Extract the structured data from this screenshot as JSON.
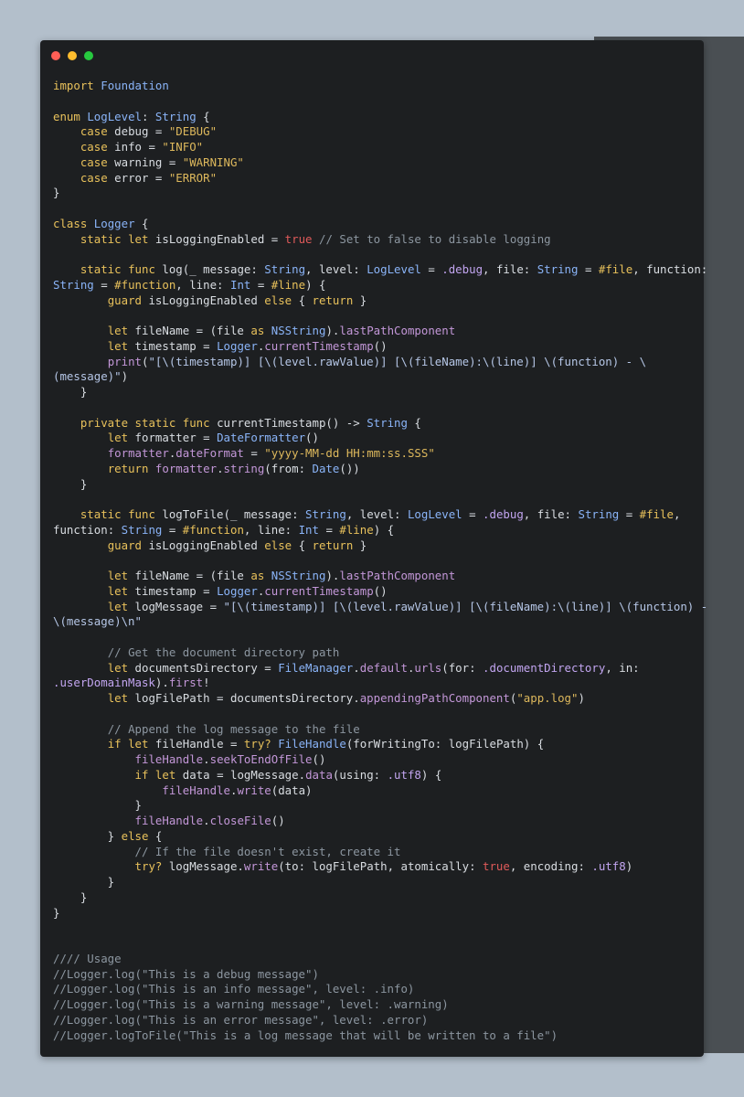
{
  "window": {
    "buttons": [
      "close",
      "minimize",
      "zoom"
    ]
  },
  "code": {
    "language": "Swift",
    "lines": [
      [
        [
          "import",
          "kw"
        ],
        [
          " ",
          "pl"
        ],
        [
          "Foundation",
          "type"
        ]
      ],
      [],
      [
        [
          "enum",
          "kw"
        ],
        [
          " ",
          "pl"
        ],
        [
          "LogLevel",
          "type"
        ],
        [
          ": ",
          "pl"
        ],
        [
          "String",
          "type"
        ],
        [
          " {",
          "pl"
        ]
      ],
      [
        [
          "    ",
          "pl"
        ],
        [
          "case",
          "kw"
        ],
        [
          " debug = ",
          "pl"
        ],
        [
          "\"DEBUG\"",
          "str"
        ]
      ],
      [
        [
          "    ",
          "pl"
        ],
        [
          "case",
          "kw"
        ],
        [
          " info = ",
          "pl"
        ],
        [
          "\"INFO\"",
          "str"
        ]
      ],
      [
        [
          "    ",
          "pl"
        ],
        [
          "case",
          "kw"
        ],
        [
          " warning = ",
          "pl"
        ],
        [
          "\"WARNING\"",
          "str"
        ]
      ],
      [
        [
          "    ",
          "pl"
        ],
        [
          "case",
          "kw"
        ],
        [
          " error = ",
          "pl"
        ],
        [
          "\"ERROR\"",
          "str"
        ]
      ],
      [
        [
          "}",
          "pl"
        ]
      ],
      [],
      [
        [
          "class",
          "kw"
        ],
        [
          " ",
          "pl"
        ],
        [
          "Logger",
          "type"
        ],
        [
          " {",
          "pl"
        ]
      ],
      [
        [
          "    ",
          "pl"
        ],
        [
          "static",
          "kw"
        ],
        [
          " ",
          "pl"
        ],
        [
          "let",
          "kw"
        ],
        [
          " isLoggingEnabled = ",
          "pl"
        ],
        [
          "true",
          "num"
        ],
        [
          " ",
          "pl"
        ],
        [
          "// Set to false to disable logging",
          "cm"
        ]
      ],
      [],
      [
        [
          "    ",
          "pl"
        ],
        [
          "static",
          "kw"
        ],
        [
          " ",
          "pl"
        ],
        [
          "func",
          "kw"
        ],
        [
          " log(_ message: ",
          "pl"
        ],
        [
          "String",
          "type"
        ],
        [
          ", level: ",
          "pl"
        ],
        [
          "LogLevel",
          "type"
        ],
        [
          " = ",
          "pl"
        ],
        [
          ".debug",
          "enum"
        ],
        [
          ", file: ",
          "pl"
        ],
        [
          "String",
          "type"
        ],
        [
          " = ",
          "pl"
        ],
        [
          "#file",
          "kw"
        ],
        [
          ", function:",
          "pl"
        ]
      ],
      [
        [
          "String",
          "type"
        ],
        [
          " = ",
          "pl"
        ],
        [
          "#function",
          "kw"
        ],
        [
          ", line: ",
          "pl"
        ],
        [
          "Int",
          "type"
        ],
        [
          " = ",
          "pl"
        ],
        [
          "#line",
          "kw"
        ],
        [
          ") {",
          "pl"
        ]
      ],
      [
        [
          "        ",
          "pl"
        ],
        [
          "guard",
          "kw"
        ],
        [
          " isLoggingEnabled ",
          "pl"
        ],
        [
          "else",
          "kw"
        ],
        [
          " { ",
          "pl"
        ],
        [
          "return",
          "kw"
        ],
        [
          " }",
          "pl"
        ]
      ],
      [],
      [
        [
          "        ",
          "pl"
        ],
        [
          "let",
          "kw"
        ],
        [
          " fileName = (file ",
          "pl"
        ],
        [
          "as",
          "kw"
        ],
        [
          " ",
          "pl"
        ],
        [
          "NSString",
          "type"
        ],
        [
          ").",
          "pl"
        ],
        [
          "lastPathComponent",
          "fn"
        ]
      ],
      [
        [
          "        ",
          "pl"
        ],
        [
          "let",
          "kw"
        ],
        [
          " timestamp = ",
          "pl"
        ],
        [
          "Logger",
          "type"
        ],
        [
          ".",
          "pl"
        ],
        [
          "currentTimestamp",
          "fn"
        ],
        [
          "()",
          "pl"
        ]
      ],
      [
        [
          "        ",
          "pl"
        ],
        [
          "print",
          "fn"
        ],
        [
          "(",
          "pl"
        ],
        [
          "\"[\\(timestamp)] [\\(level.rawValue)] [\\(fileName):\\(line)] \\(function) - \\",
          "id"
        ]
      ],
      [
        [
          "(message)\"",
          "id"
        ],
        [
          ")",
          "pl"
        ]
      ],
      [
        [
          "    }",
          "pl"
        ]
      ],
      [],
      [
        [
          "    ",
          "pl"
        ],
        [
          "private",
          "kw"
        ],
        [
          " ",
          "pl"
        ],
        [
          "static",
          "kw"
        ],
        [
          " ",
          "pl"
        ],
        [
          "func",
          "kw"
        ],
        [
          " currentTimestamp() -> ",
          "pl"
        ],
        [
          "String",
          "type"
        ],
        [
          " {",
          "pl"
        ]
      ],
      [
        [
          "        ",
          "pl"
        ],
        [
          "let",
          "kw"
        ],
        [
          " formatter = ",
          "pl"
        ],
        [
          "DateFormatter",
          "type"
        ],
        [
          "()",
          "pl"
        ]
      ],
      [
        [
          "        ",
          "pl"
        ],
        [
          "formatter",
          "fn"
        ],
        [
          ".",
          "pl"
        ],
        [
          "dateFormat",
          "fn"
        ],
        [
          " = ",
          "pl"
        ],
        [
          "\"yyyy-MM-dd HH:mm:ss.SSS\"",
          "str"
        ]
      ],
      [
        [
          "        ",
          "pl"
        ],
        [
          "return",
          "kw"
        ],
        [
          " ",
          "pl"
        ],
        [
          "formatter",
          "fn"
        ],
        [
          ".",
          "pl"
        ],
        [
          "string",
          "fn"
        ],
        [
          "(from: ",
          "pl"
        ],
        [
          "Date",
          "type"
        ],
        [
          "())",
          "pl"
        ]
      ],
      [
        [
          "    }",
          "pl"
        ]
      ],
      [],
      [
        [
          "    ",
          "pl"
        ],
        [
          "static",
          "kw"
        ],
        [
          " ",
          "pl"
        ],
        [
          "func",
          "kw"
        ],
        [
          " logToFile(_ message: ",
          "pl"
        ],
        [
          "String",
          "type"
        ],
        [
          ", level: ",
          "pl"
        ],
        [
          "LogLevel",
          "type"
        ],
        [
          " = ",
          "pl"
        ],
        [
          ".debug",
          "enum"
        ],
        [
          ", file: ",
          "pl"
        ],
        [
          "String",
          "type"
        ],
        [
          " = ",
          "pl"
        ],
        [
          "#file",
          "kw"
        ],
        [
          ",",
          "pl"
        ]
      ],
      [
        [
          "function",
          "pl"
        ],
        [
          ": ",
          "pl"
        ],
        [
          "String",
          "type"
        ],
        [
          " = ",
          "pl"
        ],
        [
          "#function",
          "kw"
        ],
        [
          ", line: ",
          "pl"
        ],
        [
          "Int",
          "type"
        ],
        [
          " = ",
          "pl"
        ],
        [
          "#line",
          "kw"
        ],
        [
          ") {",
          "pl"
        ]
      ],
      [
        [
          "        ",
          "pl"
        ],
        [
          "guard",
          "kw"
        ],
        [
          " isLoggingEnabled ",
          "pl"
        ],
        [
          "else",
          "kw"
        ],
        [
          " { ",
          "pl"
        ],
        [
          "return",
          "kw"
        ],
        [
          " }",
          "pl"
        ]
      ],
      [],
      [
        [
          "        ",
          "pl"
        ],
        [
          "let",
          "kw"
        ],
        [
          " fileName = (file ",
          "pl"
        ],
        [
          "as",
          "kw"
        ],
        [
          " ",
          "pl"
        ],
        [
          "NSString",
          "type"
        ],
        [
          ").",
          "pl"
        ],
        [
          "lastPathComponent",
          "fn"
        ]
      ],
      [
        [
          "        ",
          "pl"
        ],
        [
          "let",
          "kw"
        ],
        [
          " timestamp = ",
          "pl"
        ],
        [
          "Logger",
          "type"
        ],
        [
          ".",
          "pl"
        ],
        [
          "currentTimestamp",
          "fn"
        ],
        [
          "()",
          "pl"
        ]
      ],
      [
        [
          "        ",
          "pl"
        ],
        [
          "let",
          "kw"
        ],
        [
          " logMessage = ",
          "pl"
        ],
        [
          "\"[\\(timestamp)] [\\(level.rawValue)] [\\(fileName):\\(line)] \\(function) -",
          "id"
        ]
      ],
      [
        [
          "\\(message)\\n\"",
          "id"
        ]
      ],
      [],
      [
        [
          "        ",
          "pl"
        ],
        [
          "// Get the document directory path",
          "cm"
        ]
      ],
      [
        [
          "        ",
          "pl"
        ],
        [
          "let",
          "kw"
        ],
        [
          " documentsDirectory = ",
          "pl"
        ],
        [
          "FileManager",
          "type"
        ],
        [
          ".",
          "pl"
        ],
        [
          "default",
          "fn"
        ],
        [
          ".",
          "pl"
        ],
        [
          "urls",
          "fn"
        ],
        [
          "(for: ",
          "pl"
        ],
        [
          ".documentDirectory",
          "enum"
        ],
        [
          ", in:",
          "pl"
        ]
      ],
      [
        [
          ".userDomainMask",
          "enum"
        ],
        [
          ").",
          "pl"
        ],
        [
          "first",
          "fn"
        ],
        [
          "!",
          "pl"
        ]
      ],
      [
        [
          "        ",
          "pl"
        ],
        [
          "let",
          "kw"
        ],
        [
          " logFilePath = documentsDirectory.",
          "pl"
        ],
        [
          "appendingPathComponent",
          "fn"
        ],
        [
          "(",
          "pl"
        ],
        [
          "\"app.log\"",
          "str"
        ],
        [
          ")",
          "pl"
        ]
      ],
      [],
      [
        [
          "        ",
          "pl"
        ],
        [
          "// Append the log message to the file",
          "cm"
        ]
      ],
      [
        [
          "        ",
          "pl"
        ],
        [
          "if",
          "kw"
        ],
        [
          " ",
          "pl"
        ],
        [
          "let",
          "kw"
        ],
        [
          " fileHandle = ",
          "pl"
        ],
        [
          "try?",
          "kw"
        ],
        [
          " ",
          "pl"
        ],
        [
          "FileHandle",
          "type"
        ],
        [
          "(forWritingTo: logFilePath) {",
          "pl"
        ]
      ],
      [
        [
          "            ",
          "pl"
        ],
        [
          "fileHandle",
          "fn"
        ],
        [
          ".",
          "pl"
        ],
        [
          "seekToEndOfFile",
          "fn"
        ],
        [
          "()",
          "pl"
        ]
      ],
      [
        [
          "            ",
          "pl"
        ],
        [
          "if",
          "kw"
        ],
        [
          " ",
          "pl"
        ],
        [
          "let",
          "kw"
        ],
        [
          " data = logMessage.",
          "pl"
        ],
        [
          "data",
          "fn"
        ],
        [
          "(using: ",
          "pl"
        ],
        [
          ".utf8",
          "enum"
        ],
        [
          ") {",
          "pl"
        ]
      ],
      [
        [
          "                ",
          "pl"
        ],
        [
          "fileHandle",
          "fn"
        ],
        [
          ".",
          "pl"
        ],
        [
          "write",
          "fn"
        ],
        [
          "(data)",
          "pl"
        ]
      ],
      [
        [
          "            }",
          "pl"
        ]
      ],
      [
        [
          "            ",
          "pl"
        ],
        [
          "fileHandle",
          "fn"
        ],
        [
          ".",
          "pl"
        ],
        [
          "closeFile",
          "fn"
        ],
        [
          "()",
          "pl"
        ]
      ],
      [
        [
          "        } ",
          "pl"
        ],
        [
          "else",
          "kw"
        ],
        [
          " {",
          "pl"
        ]
      ],
      [
        [
          "            ",
          "pl"
        ],
        [
          "// If the file doesn't exist, create it",
          "cm"
        ]
      ],
      [
        [
          "            ",
          "pl"
        ],
        [
          "try?",
          "kw"
        ],
        [
          " logMessage.",
          "pl"
        ],
        [
          "write",
          "fn"
        ],
        [
          "(to: logFilePath, atomically: ",
          "pl"
        ],
        [
          "true",
          "num"
        ],
        [
          ", encoding: ",
          "pl"
        ],
        [
          ".utf8",
          "enum"
        ],
        [
          ")",
          "pl"
        ]
      ],
      [
        [
          "        }",
          "pl"
        ]
      ],
      [
        [
          "    }",
          "pl"
        ]
      ],
      [
        [
          "}",
          "pl"
        ]
      ],
      [],
      [],
      [
        [
          "//// Usage",
          "cm"
        ]
      ],
      [
        [
          "//Logger.log(\"This is a debug message\")",
          "cm"
        ]
      ],
      [
        [
          "//Logger.log(\"This is an info message\", level: .info)",
          "cm"
        ]
      ],
      [
        [
          "//Logger.log(\"This is a warning message\", level: .warning)",
          "cm"
        ]
      ],
      [
        [
          "//Logger.log(\"This is an error message\", level: .error)",
          "cm"
        ]
      ],
      [
        [
          "//Logger.logToFile(\"This is a log message that will be written to a file\")",
          "cm"
        ]
      ]
    ]
  }
}
